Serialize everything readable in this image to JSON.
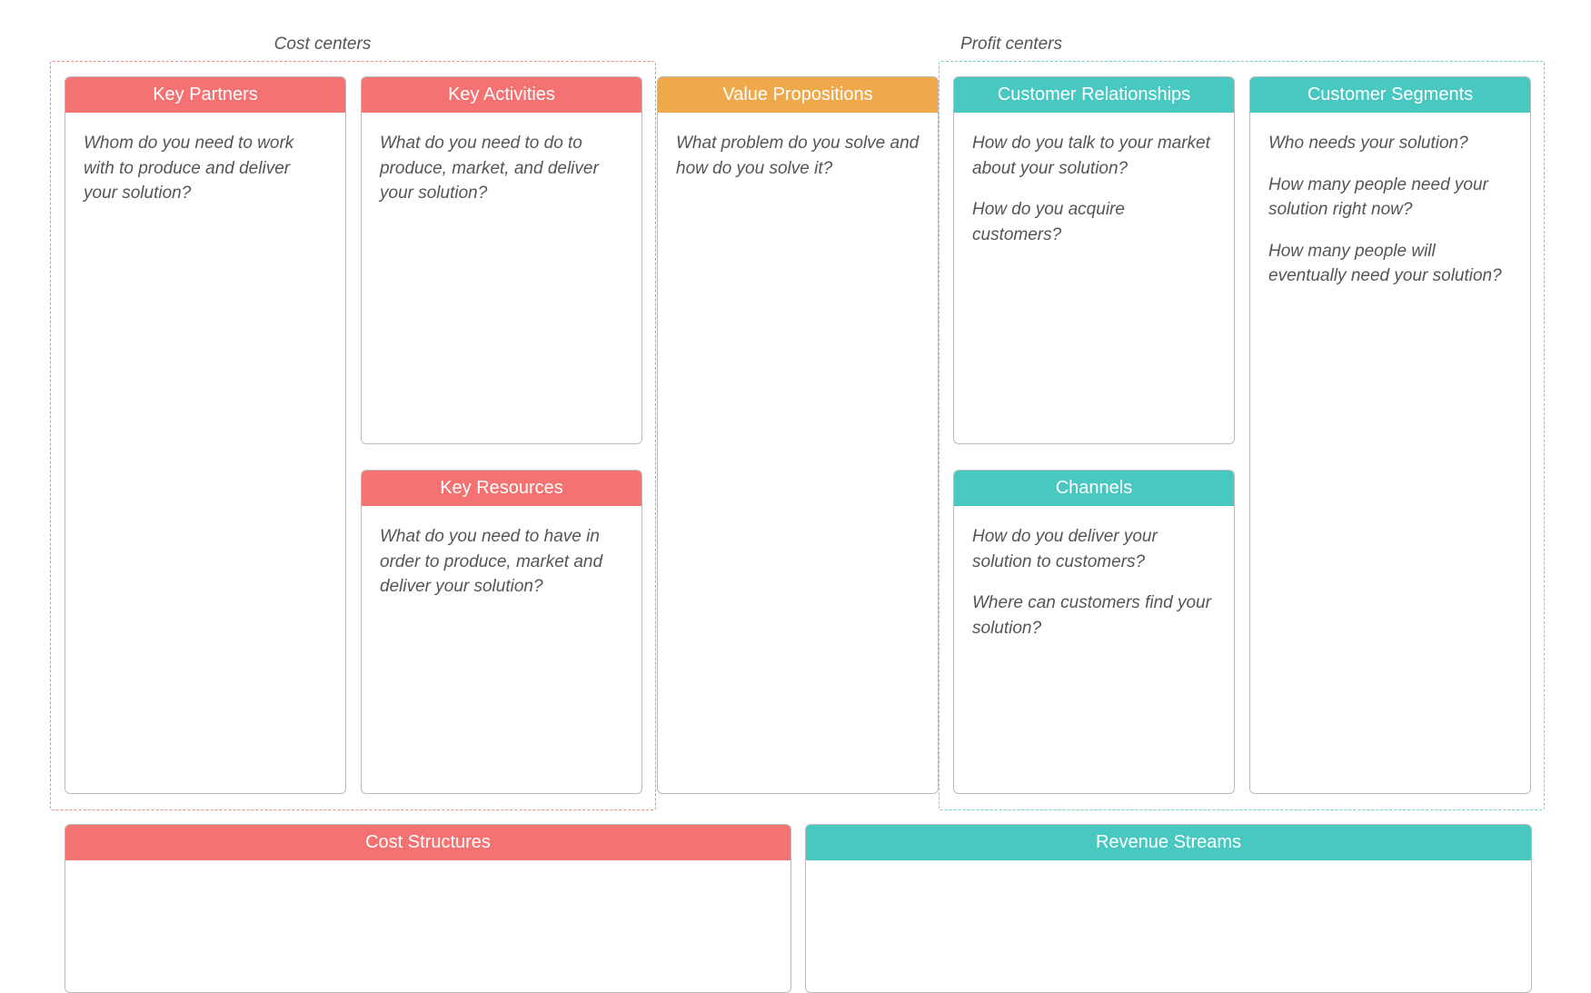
{
  "labels": {
    "cost_centers": "Cost centers",
    "profit_centers": "Profit centers"
  },
  "cards": {
    "key_partners": {
      "title": "Key Partners",
      "body": [
        "Whom do you need to work with to produce and deliver your solution?"
      ]
    },
    "key_activities": {
      "title": "Key Activities",
      "body": [
        "What do you need to do to produce, market, and deliver your solution?"
      ]
    },
    "key_resources": {
      "title": "Key Resources",
      "body": [
        "What do you need to have in order to produce, market and deliver your solution?"
      ]
    },
    "value_propositions": {
      "title": "Value Propositions",
      "body": [
        "What problem do you solve and how do you solve it?"
      ]
    },
    "customer_relationships": {
      "title": "Customer Relationships",
      "body": [
        "How do you talk to your market about your solution?",
        "How do you acquire customers?"
      ]
    },
    "channels": {
      "title": "Channels",
      "body": [
        "How do you deliver your solution to customers?",
        "Where can customers find your solution?"
      ]
    },
    "customer_segments": {
      "title": "Customer Segments",
      "body": [
        "Who needs your solution?",
        "How many people need your solution right now?",
        "How many people will eventually need your solution?"
      ]
    },
    "cost_structures": {
      "title": "Cost Structures",
      "body": []
    },
    "revenue_streams": {
      "title": "Revenue Streams",
      "body": []
    }
  }
}
